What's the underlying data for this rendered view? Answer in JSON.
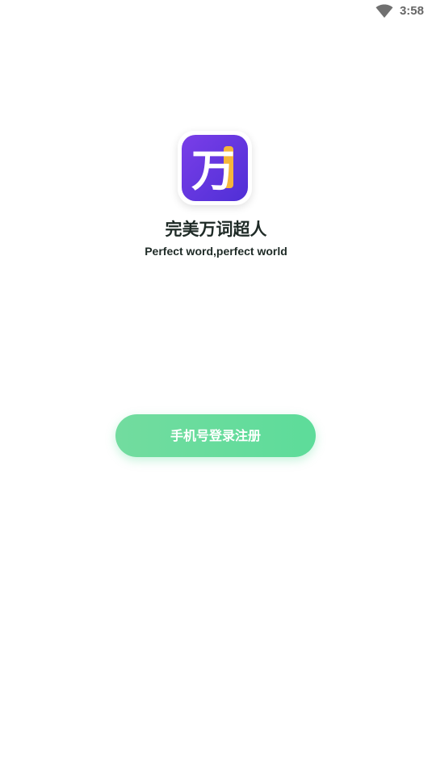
{
  "status_bar": {
    "time": "3:58",
    "icons": [
      "wifi-icon"
    ]
  },
  "app": {
    "logo_character": "万",
    "logo_colors": {
      "background_start": "#7a3ee8",
      "background_end": "#4f2fd6",
      "accent": "#f5b63a",
      "glyph": "#ffffff"
    },
    "title": "完美万词超人",
    "subtitle": "Perfect word,perfect world"
  },
  "actions": {
    "login_label": "手机号登录注册",
    "login_color": "#5ddc9a"
  }
}
